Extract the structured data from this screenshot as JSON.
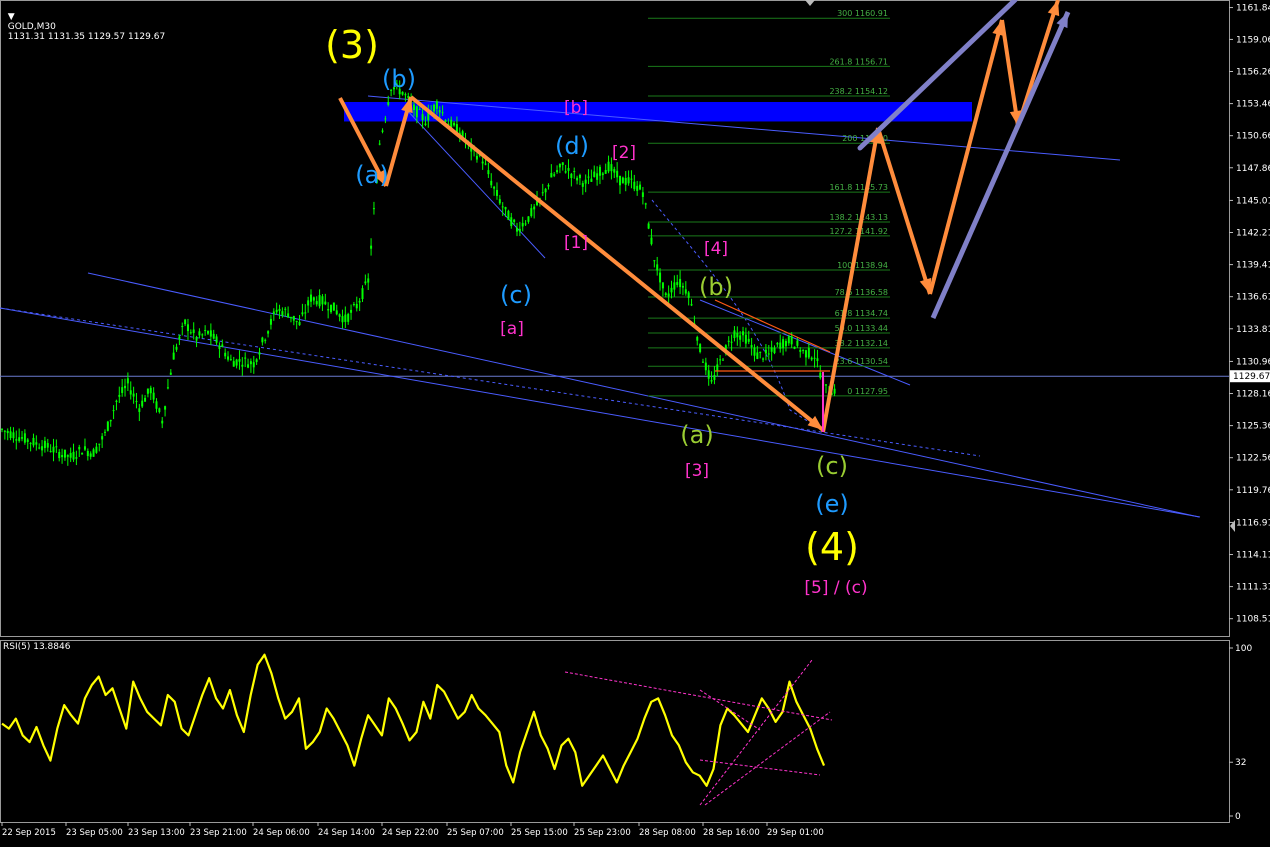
{
  "header": {
    "symbol": "GOLD,M30",
    "ohlc": "1131.31 1131.35 1129.57 1129.67"
  },
  "rsi_header": "RSI(5) 13.8846",
  "colors": {
    "background": "#000000",
    "candles": "#00ff00",
    "rsi_line": "#ffff00",
    "wave_arrows": "#ff8c3c",
    "forecast_channel": "#8080c8",
    "resistance_zone": "#0000ff",
    "trend_lines": "#4a5cff",
    "fib_lines": "#1a7a1a",
    "labels_yellow": "#ffff00",
    "labels_cyan": "#1e9bff",
    "labels_magenta": "#ff33cc",
    "labels_olive": "#9acd32"
  },
  "chart_data": [
    {
      "type": "candlestick",
      "title": "GOLD,M30",
      "ylim": [
        1107.0,
        1162.5
      ],
      "y_ticks": [
        1161.84,
        1159.06,
        1156.26,
        1153.46,
        1150.66,
        1147.86,
        1145.01,
        1142.21,
        1139.41,
        1136.61,
        1133.81,
        1130.96,
        1128.16,
        1125.36,
        1122.56,
        1119.76,
        1116.91,
        1114.11,
        1111.31,
        1108.51
      ],
      "current_price": 1129.67,
      "x_ticks": [
        "22 Sep 2015",
        "23 Sep 05:00",
        "23 Sep 13:00",
        "23 Sep 21:00",
        "24 Sep 06:00",
        "24 Sep 14:00",
        "24 Sep 22:00",
        "25 Sep 07:00",
        "25 Sep 15:00",
        "25 Sep 23:00",
        "28 Sep 08:00",
        "28 Sep 16:00",
        "29 Sep 01:00"
      ],
      "price_path": [
        1125.0,
        1124.6,
        1124.2,
        1123.8,
        1123.5,
        1123.0,
        1122.6,
        1123.3,
        1123.0,
        1124.6,
        1127.5,
        1129.0,
        1127.0,
        1128.5,
        1125.8,
        1131.5,
        1134.3,
        1133.0,
        1133.5,
        1132.5,
        1131.0,
        1131.0,
        1130.8,
        1133.2,
        1135.5,
        1135.2,
        1134.2,
        1136.5,
        1136.2,
        1135.6,
        1134.6,
        1135.8,
        1138.0,
        1150.0,
        1155.0,
        1154.5,
        1153.0,
        1152.0,
        1153.5,
        1151.8,
        1151.0,
        1149.5,
        1148.6,
        1146.0,
        1144.0,
        1142.5,
        1143.5,
        1145.0,
        1147.0,
        1148.0,
        1147.2,
        1146.5,
        1147.3,
        1148.0,
        1146.8,
        1146.6,
        1145.8,
        1140.0,
        1136.5,
        1138.0,
        1137.0,
        1132.0,
        1129.0,
        1131.5,
        1133.5,
        1133.0,
        1131.5,
        1131.5,
        1132.5,
        1132.8,
        1131.8,
        1131.5,
        1128.5
      ],
      "fibonacci": [
        {
          "level": "300",
          "price": 1160.91
        },
        {
          "level": "261.8",
          "price": 1156.71
        },
        {
          "level": "238.2",
          "price": 1154.12
        },
        {
          "level": "200",
          "price": 1150.0
        },
        {
          "level": "161.8",
          "price": 1145.73
        },
        {
          "level": "138.2",
          "price": 1143.13
        },
        {
          "level": "127.2",
          "price": 1141.92
        },
        {
          "level": "100",
          "price": 1138.94
        },
        {
          "level": "78.6",
          "price": 1136.58
        },
        {
          "level": "61.8",
          "price": 1134.74
        },
        {
          "level": "50.0",
          "price": 1133.44
        },
        {
          "level": "38.2",
          "price": 1132.14
        },
        {
          "level": "23.6",
          "price": 1130.54
        },
        {
          "level": "0",
          "price": 1127.95
        }
      ],
      "fib_label_texts": [
        "300 1160.91",
        "261.8 1156.71",
        "238.2 1154.12",
        "200 1150.0",
        "161.8 1145.73",
        "138.2 1143.13",
        "127.2 1141.92",
        "100 1138.94",
        "78.6 1136.58",
        "61.8 1134.74",
        "50.0 1133.44",
        "38.2 1132.14",
        "23.6 1130.54",
        "0 1127.95"
      ],
      "wave_labels": [
        {
          "text": "(3)",
          "color": "yellow",
          "size": "large"
        },
        {
          "text": "(b)",
          "color": "cyan",
          "size": "medium"
        },
        {
          "text": "(a)",
          "color": "cyan",
          "size": "medium"
        },
        {
          "text": "[b]",
          "color": "magenta",
          "size": "small"
        },
        {
          "text": "(d)",
          "color": "cyan",
          "size": "medium"
        },
        {
          "text": "[2]",
          "color": "magenta",
          "size": "small"
        },
        {
          "text": "[1]",
          "color": "magenta",
          "size": "small"
        },
        {
          "text": "(c)",
          "color": "cyan",
          "size": "medium"
        },
        {
          "text": "[a]",
          "color": "magenta",
          "size": "small"
        },
        {
          "text": "[4]",
          "color": "magenta",
          "size": "small"
        },
        {
          "text": "(b)",
          "color": "olive",
          "size": "medium"
        },
        {
          "text": "(a)",
          "color": "olive",
          "size": "medium"
        },
        {
          "text": "[3]",
          "color": "magenta",
          "size": "small"
        },
        {
          "text": "(c)",
          "color": "olive",
          "size": "medium"
        },
        {
          "text": "(e)",
          "color": "cyan",
          "size": "medium"
        },
        {
          "text": "(4)",
          "color": "yellow",
          "size": "large"
        },
        {
          "text": "[5] / (c)",
          "color": "magenta",
          "size": "small"
        }
      ]
    },
    {
      "type": "line",
      "title": "RSI(5) 13.8846",
      "ylim": [
        0,
        100
      ],
      "y_ticks": [
        100,
        32,
        0
      ],
      "values": [
        55,
        52,
        58,
        48,
        44,
        53,
        42,
        33,
        52,
        66,
        60,
        55,
        70,
        78,
        83,
        72,
        76,
        64,
        52,
        80,
        70,
        62,
        58,
        54,
        72,
        68,
        52,
        48,
        60,
        72,
        82,
        70,
        64,
        75,
        60,
        50,
        72,
        90,
        96,
        85,
        70,
        58,
        62,
        70,
        40,
        44,
        50,
        64,
        58,
        50,
        42,
        30,
        46,
        60,
        54,
        48,
        70,
        64,
        55,
        45,
        50,
        68,
        58,
        78,
        74,
        66,
        58,
        62,
        72,
        64,
        60,
        55,
        50,
        30,
        20,
        38,
        50,
        62,
        48,
        40,
        28,
        42,
        46,
        38,
        18,
        24,
        30,
        36,
        28,
        20,
        30,
        38,
        46,
        58,
        68,
        70,
        60,
        48,
        42,
        32,
        26,
        24,
        18,
        28,
        54,
        64,
        60,
        55,
        50,
        60,
        70,
        64,
        56,
        62,
        80,
        68,
        60,
        52,
        40,
        30
      ]
    }
  ]
}
